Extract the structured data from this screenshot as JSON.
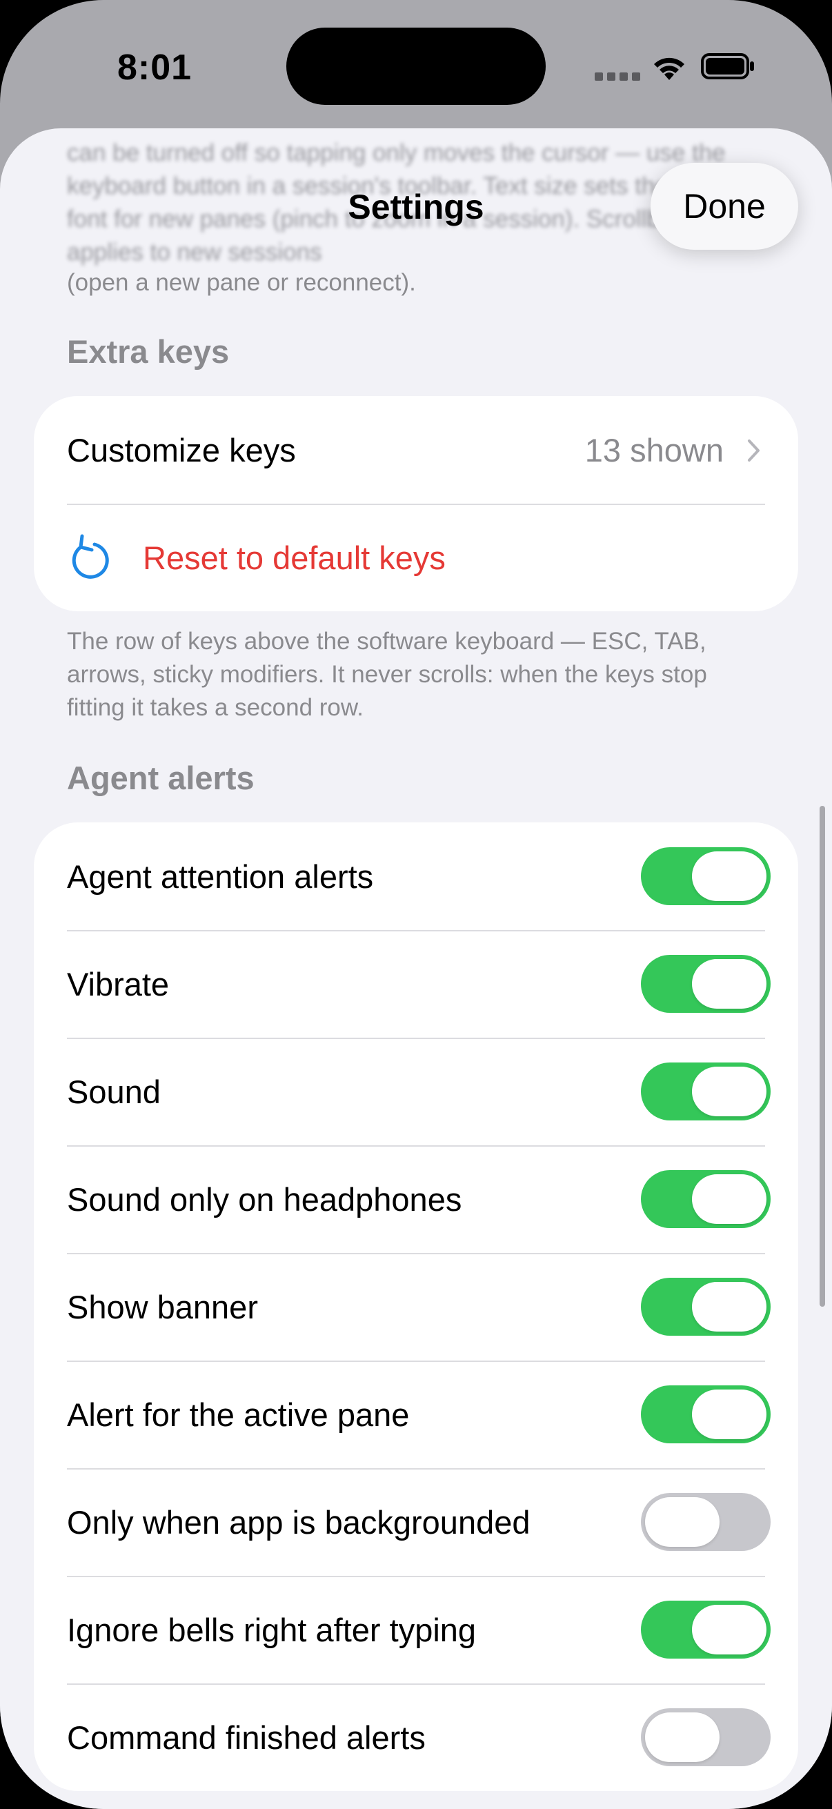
{
  "status_bar": {
    "time": "8:01"
  },
  "sheet": {
    "title": "Settings",
    "done_label": "Done",
    "top_note_faded": "can be turned off so tapping only moves the cursor — use the keyboard button in a session's toolbar. Text size sets the terminal font for new panes (pinch to zoom in a session). Scrollback applies to new sessions",
    "top_note_visible": "(open a new pane or reconnect)."
  },
  "extra_keys": {
    "header": "Extra keys",
    "customize_label": "Customize keys",
    "customize_value": "13 shown",
    "reset_label": "Reset to default keys",
    "footnote": "The row of keys above the software keyboard — ESC, TAB, arrows, sticky modifiers. It never scrolls: when the keys stop fitting it takes a second row."
  },
  "agent_alerts": {
    "header": "Agent alerts",
    "rows": [
      {
        "label": "Agent attention alerts",
        "on": true
      },
      {
        "label": "Vibrate",
        "on": true
      },
      {
        "label": "Sound",
        "on": true
      },
      {
        "label": "Sound only on headphones",
        "on": true
      },
      {
        "label": "Show banner",
        "on": true
      },
      {
        "label": "Alert for the active pane",
        "on": true
      },
      {
        "label": "Only when app is backgrounded",
        "on": false
      },
      {
        "label": "Ignore bells right after typing",
        "on": true
      },
      {
        "label": "Command finished alerts",
        "on": false
      }
    ]
  },
  "colors": {
    "accent_green": "#34c759",
    "destructive_red": "#e53935",
    "link_blue": "#1e88e5"
  }
}
